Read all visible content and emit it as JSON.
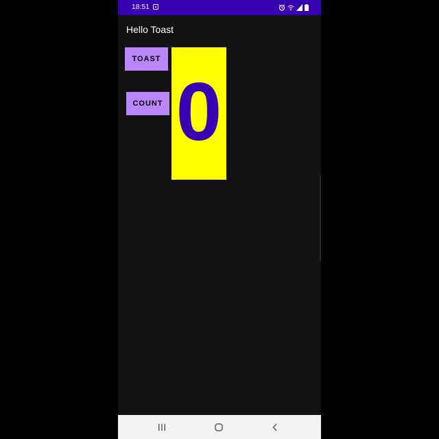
{
  "status_bar": {
    "time": "18:51",
    "left_icon": "instagram-icon",
    "right_icons": [
      "alarm-icon",
      "wifi-call-icon",
      "signal-icon",
      "battery-icon"
    ],
    "background": "#3700b3"
  },
  "app": {
    "title": "Hello Toast",
    "background": "#121212"
  },
  "buttons": {
    "toast_label": "TOAST",
    "count_label": "COUNT",
    "color": "#bb86fc"
  },
  "counter": {
    "value": "0",
    "background": "#ffff00",
    "text_color": "#3700b3"
  },
  "nav_bar": {
    "icons": [
      "recent-apps-icon",
      "home-icon",
      "back-icon"
    ]
  }
}
